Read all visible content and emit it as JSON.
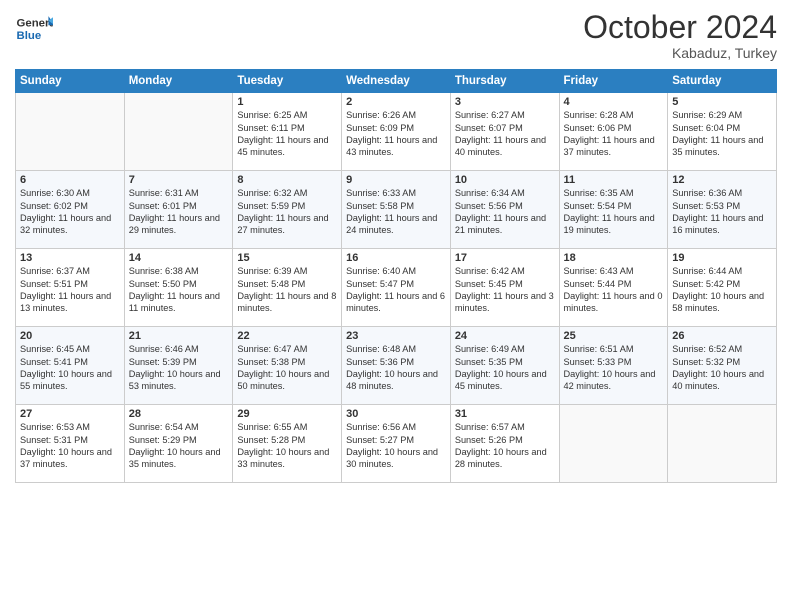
{
  "header": {
    "logo_line1": "General",
    "logo_line2": "Blue",
    "month": "October 2024",
    "location": "Kabaduz, Turkey"
  },
  "weekdays": [
    "Sunday",
    "Monday",
    "Tuesday",
    "Wednesday",
    "Thursday",
    "Friday",
    "Saturday"
  ],
  "weeks": [
    [
      {
        "day": "",
        "info": ""
      },
      {
        "day": "",
        "info": ""
      },
      {
        "day": "1",
        "info": "Sunrise: 6:25 AM\nSunset: 6:11 PM\nDaylight: 11 hours and 45 minutes."
      },
      {
        "day": "2",
        "info": "Sunrise: 6:26 AM\nSunset: 6:09 PM\nDaylight: 11 hours and 43 minutes."
      },
      {
        "day": "3",
        "info": "Sunrise: 6:27 AM\nSunset: 6:07 PM\nDaylight: 11 hours and 40 minutes."
      },
      {
        "day": "4",
        "info": "Sunrise: 6:28 AM\nSunset: 6:06 PM\nDaylight: 11 hours and 37 minutes."
      },
      {
        "day": "5",
        "info": "Sunrise: 6:29 AM\nSunset: 6:04 PM\nDaylight: 11 hours and 35 minutes."
      }
    ],
    [
      {
        "day": "6",
        "info": "Sunrise: 6:30 AM\nSunset: 6:02 PM\nDaylight: 11 hours and 32 minutes."
      },
      {
        "day": "7",
        "info": "Sunrise: 6:31 AM\nSunset: 6:01 PM\nDaylight: 11 hours and 29 minutes."
      },
      {
        "day": "8",
        "info": "Sunrise: 6:32 AM\nSunset: 5:59 PM\nDaylight: 11 hours and 27 minutes."
      },
      {
        "day": "9",
        "info": "Sunrise: 6:33 AM\nSunset: 5:58 PM\nDaylight: 11 hours and 24 minutes."
      },
      {
        "day": "10",
        "info": "Sunrise: 6:34 AM\nSunset: 5:56 PM\nDaylight: 11 hours and 21 minutes."
      },
      {
        "day": "11",
        "info": "Sunrise: 6:35 AM\nSunset: 5:54 PM\nDaylight: 11 hours and 19 minutes."
      },
      {
        "day": "12",
        "info": "Sunrise: 6:36 AM\nSunset: 5:53 PM\nDaylight: 11 hours and 16 minutes."
      }
    ],
    [
      {
        "day": "13",
        "info": "Sunrise: 6:37 AM\nSunset: 5:51 PM\nDaylight: 11 hours and 13 minutes."
      },
      {
        "day": "14",
        "info": "Sunrise: 6:38 AM\nSunset: 5:50 PM\nDaylight: 11 hours and 11 minutes."
      },
      {
        "day": "15",
        "info": "Sunrise: 6:39 AM\nSunset: 5:48 PM\nDaylight: 11 hours and 8 minutes."
      },
      {
        "day": "16",
        "info": "Sunrise: 6:40 AM\nSunset: 5:47 PM\nDaylight: 11 hours and 6 minutes."
      },
      {
        "day": "17",
        "info": "Sunrise: 6:42 AM\nSunset: 5:45 PM\nDaylight: 11 hours and 3 minutes."
      },
      {
        "day": "18",
        "info": "Sunrise: 6:43 AM\nSunset: 5:44 PM\nDaylight: 11 hours and 0 minutes."
      },
      {
        "day": "19",
        "info": "Sunrise: 6:44 AM\nSunset: 5:42 PM\nDaylight: 10 hours and 58 minutes."
      }
    ],
    [
      {
        "day": "20",
        "info": "Sunrise: 6:45 AM\nSunset: 5:41 PM\nDaylight: 10 hours and 55 minutes."
      },
      {
        "day": "21",
        "info": "Sunrise: 6:46 AM\nSunset: 5:39 PM\nDaylight: 10 hours and 53 minutes."
      },
      {
        "day": "22",
        "info": "Sunrise: 6:47 AM\nSunset: 5:38 PM\nDaylight: 10 hours and 50 minutes."
      },
      {
        "day": "23",
        "info": "Sunrise: 6:48 AM\nSunset: 5:36 PM\nDaylight: 10 hours and 48 minutes."
      },
      {
        "day": "24",
        "info": "Sunrise: 6:49 AM\nSunset: 5:35 PM\nDaylight: 10 hours and 45 minutes."
      },
      {
        "day": "25",
        "info": "Sunrise: 6:51 AM\nSunset: 5:33 PM\nDaylight: 10 hours and 42 minutes."
      },
      {
        "day": "26",
        "info": "Sunrise: 6:52 AM\nSunset: 5:32 PM\nDaylight: 10 hours and 40 minutes."
      }
    ],
    [
      {
        "day": "27",
        "info": "Sunrise: 6:53 AM\nSunset: 5:31 PM\nDaylight: 10 hours and 37 minutes."
      },
      {
        "day": "28",
        "info": "Sunrise: 6:54 AM\nSunset: 5:29 PM\nDaylight: 10 hours and 35 minutes."
      },
      {
        "day": "29",
        "info": "Sunrise: 6:55 AM\nSunset: 5:28 PM\nDaylight: 10 hours and 33 minutes."
      },
      {
        "day": "30",
        "info": "Sunrise: 6:56 AM\nSunset: 5:27 PM\nDaylight: 10 hours and 30 minutes."
      },
      {
        "day": "31",
        "info": "Sunrise: 6:57 AM\nSunset: 5:26 PM\nDaylight: 10 hours and 28 minutes."
      },
      {
        "day": "",
        "info": ""
      },
      {
        "day": "",
        "info": ""
      }
    ]
  ]
}
